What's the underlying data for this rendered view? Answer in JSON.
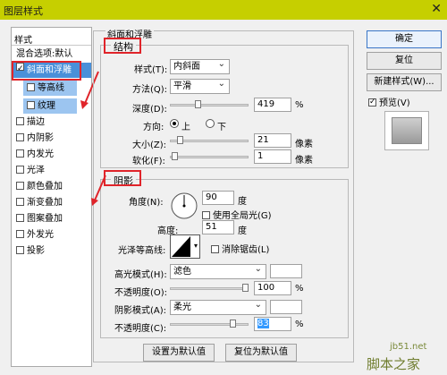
{
  "window": {
    "title": "图层样式",
    "close": "✕"
  },
  "sidebar": {
    "header": "样式",
    "items": [
      {
        "label": "混合选项:默认",
        "checkbox": false,
        "checked": false,
        "selected": false
      },
      {
        "label": "斜面和浮雕",
        "checkbox": true,
        "checked": true,
        "selected": true
      },
      {
        "label": "等高线",
        "checkbox": true,
        "checked": false,
        "selected": false,
        "sub": true
      },
      {
        "label": "纹理",
        "checkbox": true,
        "checked": false,
        "selected": false,
        "sub": true
      },
      {
        "label": "描边",
        "checkbox": true,
        "checked": false
      },
      {
        "label": "内阴影",
        "checkbox": true,
        "checked": false
      },
      {
        "label": "内发光",
        "checkbox": true,
        "checked": false
      },
      {
        "label": "光泽",
        "checkbox": true,
        "checked": false
      },
      {
        "label": "颜色叠加",
        "checkbox": true,
        "checked": false
      },
      {
        "label": "渐变叠加",
        "checkbox": true,
        "checked": false
      },
      {
        "label": "图案叠加",
        "checkbox": true,
        "checked": false
      },
      {
        "label": "外发光",
        "checkbox": true,
        "checked": false
      },
      {
        "label": "投影",
        "checkbox": true,
        "checked": false
      }
    ]
  },
  "main": {
    "group_title": "斜面和浮雕",
    "structure": {
      "title": "结构",
      "style_label": "样式(T):",
      "style_value": "内斜面",
      "method_label": "方法(Q):",
      "method_value": "平滑",
      "depth_label": "深度(D):",
      "depth_value": "419",
      "depth_unit": "%",
      "depth_level": 0.35,
      "direction_label": "方向:",
      "dir_up": "上",
      "dir_down": "下",
      "size_label": "大小(Z):",
      "size_value": "21",
      "size_unit": "像素",
      "size_level": 0.1,
      "soften_label": "软化(F):",
      "soften_value": "1",
      "soften_unit": "像素",
      "soften_level": 0.02
    },
    "shading": {
      "title": "阴影",
      "angle_label": "角度(N):",
      "angle_value": "90",
      "angle_unit": "度",
      "global_light_label": "使用全局光(G)",
      "altitude_label": "高度:",
      "altitude_value": "51",
      "altitude_unit": "度",
      "gloss_label": "光泽等高线:",
      "antialias_label": "消除锯齿(L)",
      "highlight_mode_label": "高光模式(H):",
      "highlight_mode_value": "滤色",
      "highlight_opacity_label": "不透明度(O):",
      "highlight_opacity_value": "100",
      "highlight_opacity_unit": "%",
      "highlight_opacity_level": 1.0,
      "shadow_mode_label": "阴影模式(A):",
      "shadow_mode_value": "柔光",
      "shadow_opacity_label": "不透明度(C):",
      "shadow_opacity_value": "83",
      "shadow_opacity_unit": "%",
      "shadow_opacity_level": 0.83
    },
    "btn_set_default": "设置为默认值",
    "btn_reset_default": "复位为默认值"
  },
  "right": {
    "ok": "确定",
    "reset": "复位",
    "new_style": "新建样式(W)...",
    "preview_label": "预览(V)"
  },
  "watermark": {
    "site": "jb51.net",
    "name": "脚本之家"
  },
  "colors": {
    "titlebar": "#c6cf00",
    "selected": "#9cc5f0",
    "highlight_red": "#e0242a"
  }
}
